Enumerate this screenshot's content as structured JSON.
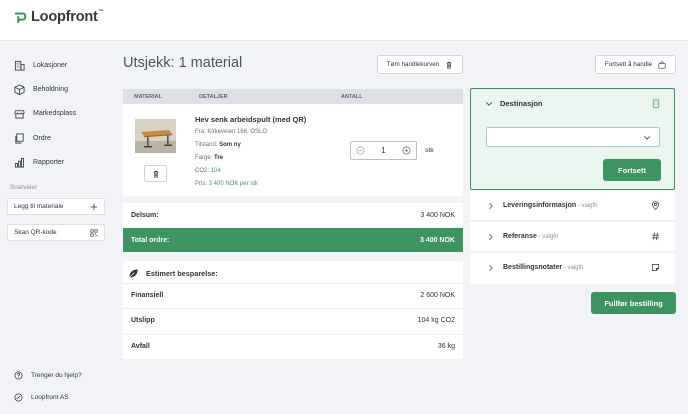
{
  "app": {
    "logo_text": "Loopfront",
    "logo_tm": "™"
  },
  "nav": [
    {
      "label": "Lokasjoner",
      "icon": "building-icon"
    },
    {
      "label": "Beholdning",
      "icon": "box-icon"
    },
    {
      "label": "Markedsplass",
      "icon": "store-icon"
    },
    {
      "label": "Ordre",
      "icon": "orders-icon"
    },
    {
      "label": "Rapporter",
      "icon": "bar-chart-icon"
    }
  ],
  "shortcuts": {
    "heading": "Snarveier",
    "items": [
      {
        "label": "Legg til materiale",
        "icon": "plus-icon"
      },
      {
        "label": "Skan QR-kode",
        "icon": "qr-icon"
      }
    ]
  },
  "footer": {
    "help": "Trenger du hjelp?",
    "company": "Loopfront AS"
  },
  "page": {
    "title": "Utsjekk: 1 material",
    "clear_cart": "Tøm handlekurven",
    "continue_shopping": "Fortsett å handle"
  },
  "table": {
    "headers": {
      "material": "MATERIAL",
      "details": "DETALJER",
      "quantity": "ANTALL"
    }
  },
  "product": {
    "name": "Hev senk arbeidspult (med QR)",
    "from": "Fra: Kirkeveien 166, OSLO",
    "condition_label": "Tilstand:",
    "condition_value": "Som ny",
    "color_label": "Farge:",
    "color_value": "Tre",
    "co2_label": "CO2:",
    "co2_value": "104",
    "price_label": "Pris:",
    "price_value": "3 400 NOK per stk",
    "quantity": "1",
    "unit": "stk"
  },
  "summary": {
    "subtotal_label": "Delsum:",
    "subtotal_value": "3 400 NOK",
    "total_label": "Total ordre:",
    "total_value": "3 400 NOK"
  },
  "savings": {
    "title": "Estimert besparelse:",
    "rows": [
      {
        "label": "Finansiell",
        "value": "2 600 NOK"
      },
      {
        "label": "Utslipp",
        "value": "104 kg CO2"
      },
      {
        "label": "Avfall",
        "value": "36 kg"
      }
    ]
  },
  "destination": {
    "title": "Destinasjon",
    "select_value": "",
    "continue": "Fortsett"
  },
  "accordion": [
    {
      "label": "Leveringsinformasjon",
      "optional": " - valgfri",
      "icon": "location-pin-icon"
    },
    {
      "label": "Referanse",
      "optional": " - valgfri",
      "icon": "hash-icon"
    },
    {
      "label": "Bestillingsnotater",
      "optional": " - valgfri",
      "icon": "note-icon"
    }
  ],
  "complete_order": "Fullfør bestilling",
  "colors": {
    "accent": "#3d9460",
    "accent_light": "#e9f5ee",
    "background": "#f1f3f7"
  }
}
